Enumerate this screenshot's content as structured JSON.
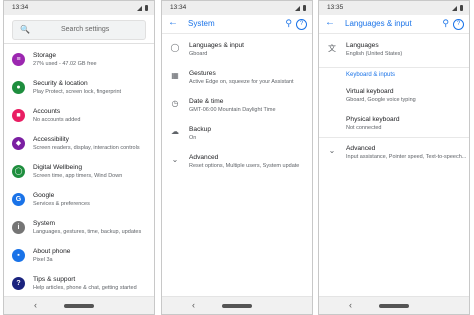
{
  "panel1": {
    "time": "13:34",
    "search_placeholder": "Search settings",
    "items": [
      {
        "title": "Storage",
        "subtitle": "27% used - 47.02 GB free",
        "icon": "storage-icon",
        "color": "#9c27b0"
      },
      {
        "title": "Security & location",
        "subtitle": "Play Protect, screen lock, fingerprint",
        "icon": "lock-icon",
        "color": "#1e8e3e"
      },
      {
        "title": "Accounts",
        "subtitle": "No accounts added",
        "icon": "account-icon",
        "color": "#e91e63"
      },
      {
        "title": "Accessibility",
        "subtitle": "Screen readers, display, interaction controls",
        "icon": "accessibility-icon",
        "color": "#7b1fa2"
      },
      {
        "title": "Digital Wellbeing",
        "subtitle": "Screen time, app timers, Wind Down",
        "icon": "wellbeing-icon",
        "color": "#1e8e3e"
      },
      {
        "title": "Google",
        "subtitle": "Services & preferences",
        "icon": "google-icon",
        "color": "#1a73e8"
      },
      {
        "title": "System",
        "subtitle": "Languages, gestures, time, backup, updates",
        "icon": "info-icon",
        "color": "#757575"
      },
      {
        "title": "About phone",
        "subtitle": "Pixel 3a",
        "icon": "phone-icon",
        "color": "#1a73e8"
      },
      {
        "title": "Tips & support",
        "subtitle": "Help articles, phone & chat, getting started",
        "icon": "help-icon",
        "color": "#1a237e"
      }
    ]
  },
  "panel2": {
    "time": "13:34",
    "title": "System",
    "items": [
      {
        "title": "Languages & input",
        "subtitle": "Gboard",
        "icon": "globe-icon"
      },
      {
        "title": "Gestures",
        "subtitle": "Active Edge on, squeeze for your Assistant",
        "icon": "gesture-icon"
      },
      {
        "title": "Date & time",
        "subtitle": "GMT-06:00 Mountain Daylight Time",
        "icon": "clock-icon"
      },
      {
        "title": "Backup",
        "subtitle": "On",
        "icon": "cloud-icon"
      },
      {
        "title": "Advanced",
        "subtitle": "Reset options, Multiple users, System update",
        "icon": "chevron-down-icon"
      }
    ]
  },
  "panel3": {
    "time": "13:35",
    "title": "Languages & input",
    "items": [
      {
        "title": "Languages",
        "subtitle": "English (United States)",
        "icon": "translate-icon"
      }
    ],
    "section": "Keyboard & inputs",
    "keyboard_items": [
      {
        "title": "Virtual keyboard",
        "subtitle": "Gboard, Google voice typing"
      },
      {
        "title": "Physical keyboard",
        "subtitle": "Not connected"
      }
    ],
    "advanced": {
      "title": "Advanced",
      "subtitle": "Input assistance, Pointer speed, Text-to-speech..."
    }
  },
  "colors": {
    "accent": "#1a73e8"
  }
}
